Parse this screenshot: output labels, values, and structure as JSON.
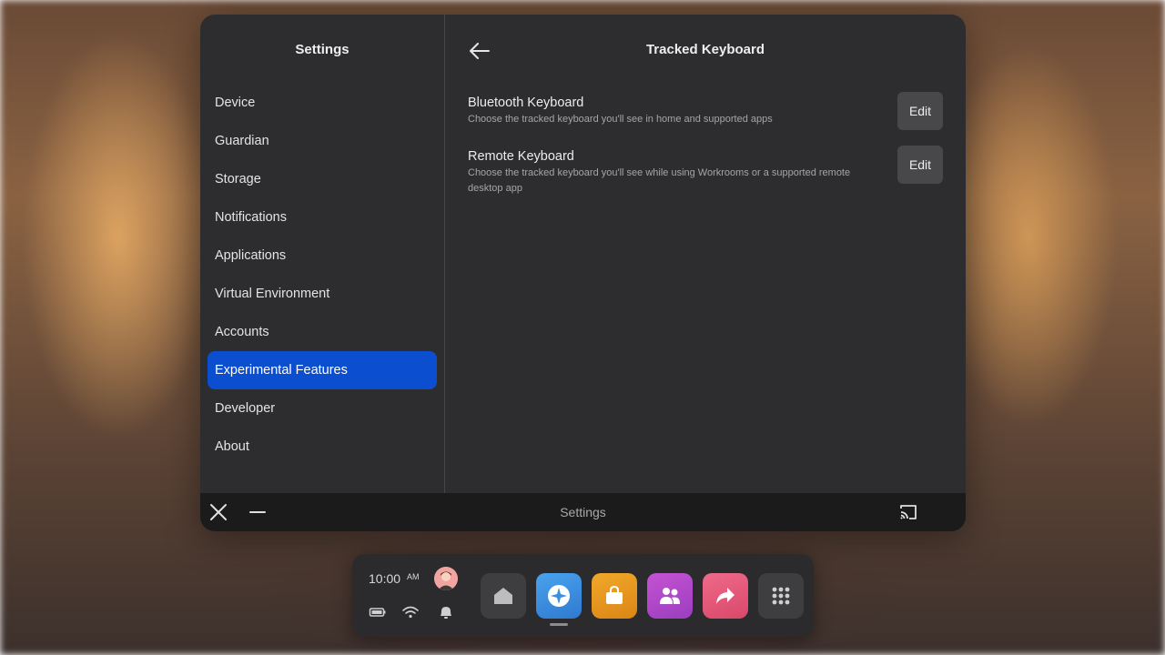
{
  "sidebar": {
    "title": "Settings",
    "items": [
      {
        "label": "Device"
      },
      {
        "label": "Guardian"
      },
      {
        "label": "Storage"
      },
      {
        "label": "Notifications"
      },
      {
        "label": "Applications"
      },
      {
        "label": "Virtual Environment"
      },
      {
        "label": "Accounts"
      },
      {
        "label": "Experimental Features",
        "active": true
      },
      {
        "label": "Developer"
      },
      {
        "label": "About"
      }
    ]
  },
  "main": {
    "title": "Tracked Keyboard",
    "options": [
      {
        "title": "Bluetooth Keyboard",
        "description": "Choose the tracked keyboard you'll see in home and supported apps",
        "button_label": "Edit"
      },
      {
        "title": "Remote Keyboard",
        "description": "Choose the tracked keyboard you'll see while using Workrooms or a supported remote desktop app",
        "button_label": "Edit"
      }
    ]
  },
  "bottom_bar": {
    "title": "Settings"
  },
  "dock": {
    "time": "10:00",
    "ampm": "AM",
    "status_icons": [
      "battery-icon",
      "wifi-icon",
      "bell-icon"
    ],
    "apps": [
      {
        "name": "home-icon",
        "color": "#3e3e41"
      },
      {
        "name": "explore-icon",
        "color": "#3b8fe0"
      },
      {
        "name": "store-icon",
        "color": "#e79a1f"
      },
      {
        "name": "people-icon",
        "color": "#b548c8"
      },
      {
        "name": "share-icon",
        "color": "#e3587a"
      },
      {
        "name": "app-library-icon",
        "color": "#3e3e41"
      }
    ]
  },
  "colors": {
    "accent": "#0b4ecf",
    "panel": "#2d2d2f",
    "bottom_bar": "#1b1b1c"
  }
}
